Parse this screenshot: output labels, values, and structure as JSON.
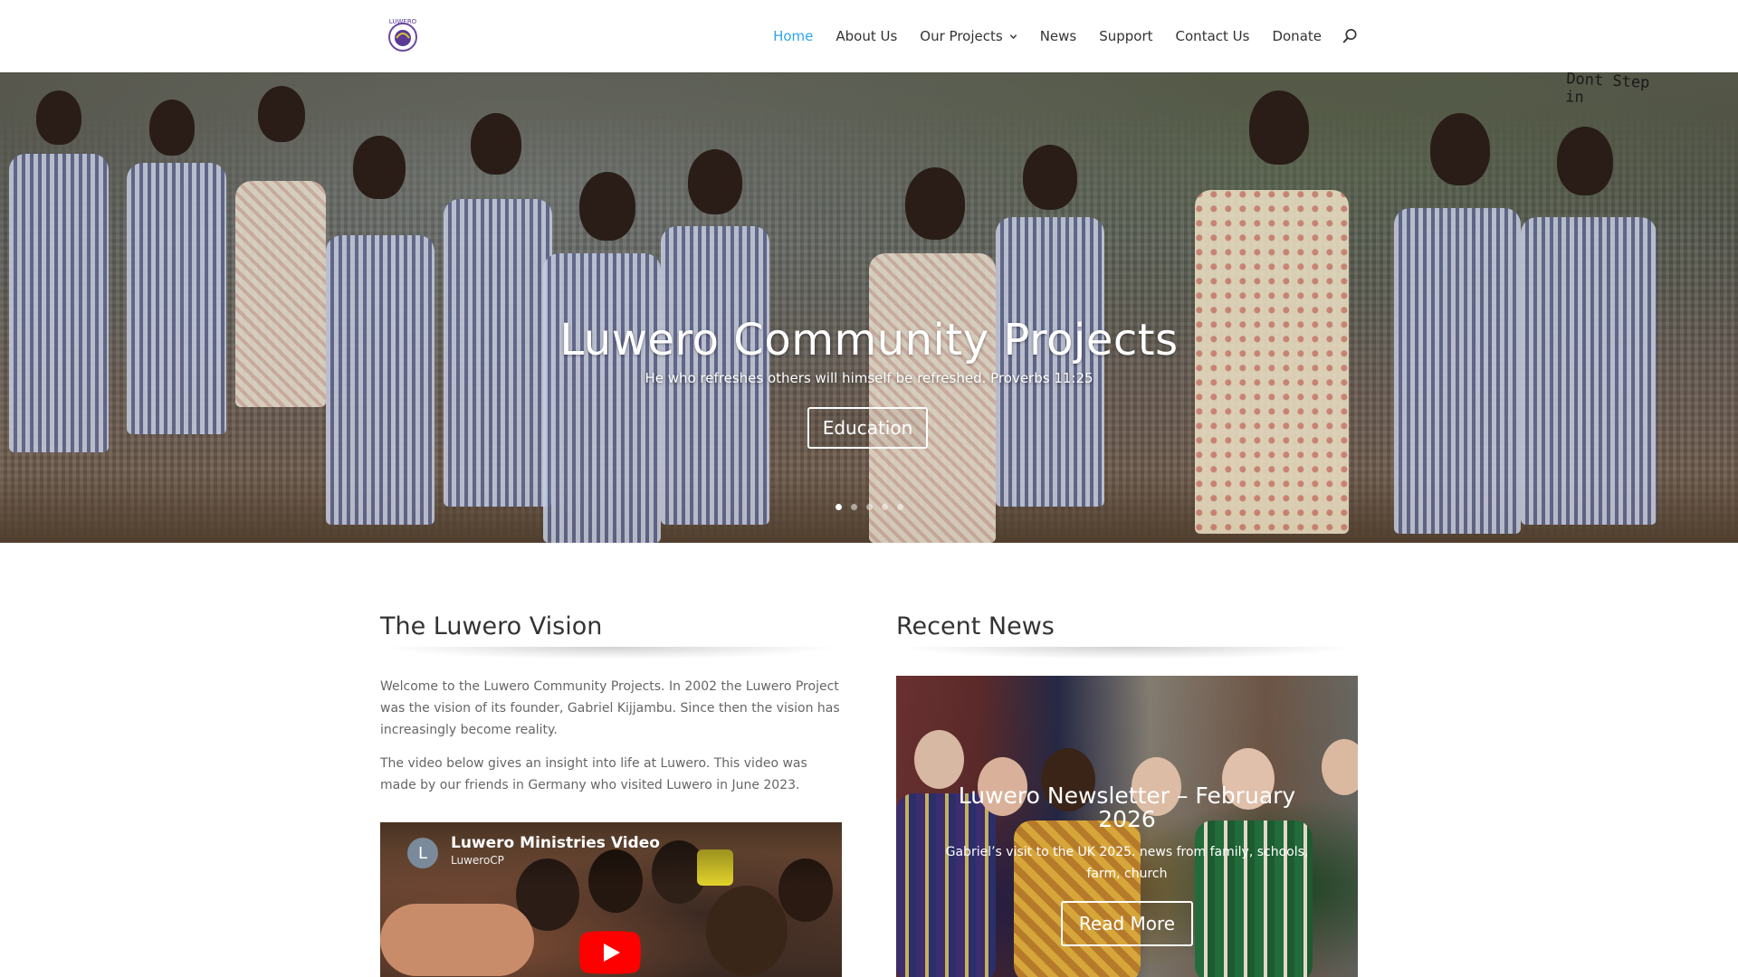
{
  "header": {
    "logo_text": "LUWERO",
    "nav": [
      {
        "label": "Home",
        "active": true
      },
      {
        "label": "About Us"
      },
      {
        "label": "Our Projects",
        "has_dropdown": true
      },
      {
        "label": "News"
      },
      {
        "label": "Support"
      },
      {
        "label": "Contact Us"
      },
      {
        "label": "Donate"
      }
    ],
    "search_icon": "search-icon",
    "accent_color": "#2ea3f2"
  },
  "hero": {
    "title": "Luwero Community Projects",
    "subtitle": "He who refreshes others will himself be refreshed. Proverbs 11:25",
    "button_label": "Education",
    "slides_count": 5,
    "active_slide": 1,
    "background_note_text": "Dont Step in"
  },
  "vision": {
    "heading": "The Luwero Vision",
    "paragraph1": "Welcome to the Luwero Community Projects. In 2002 the Luwero Project was the vision of its founder, Gabriel Kijjambu. Since then the vision has increasingly become reality.",
    "paragraph2": "The video below gives an insight into life at Luwero. This video was made by our friends in Germany who visited Luwero in June 2023.",
    "video": {
      "avatar_letter": "L",
      "title": "Luwero Ministries Video",
      "channel": "LuweroCP",
      "play_icon": "youtube-play-icon"
    }
  },
  "news": {
    "heading": "Recent News",
    "card": {
      "title": "Luwero Newsletter – February 2026",
      "excerpt": "Gabriel’s visit to the UK 2025. news from family, schools, farm, church",
      "button_label": "Read More"
    }
  }
}
